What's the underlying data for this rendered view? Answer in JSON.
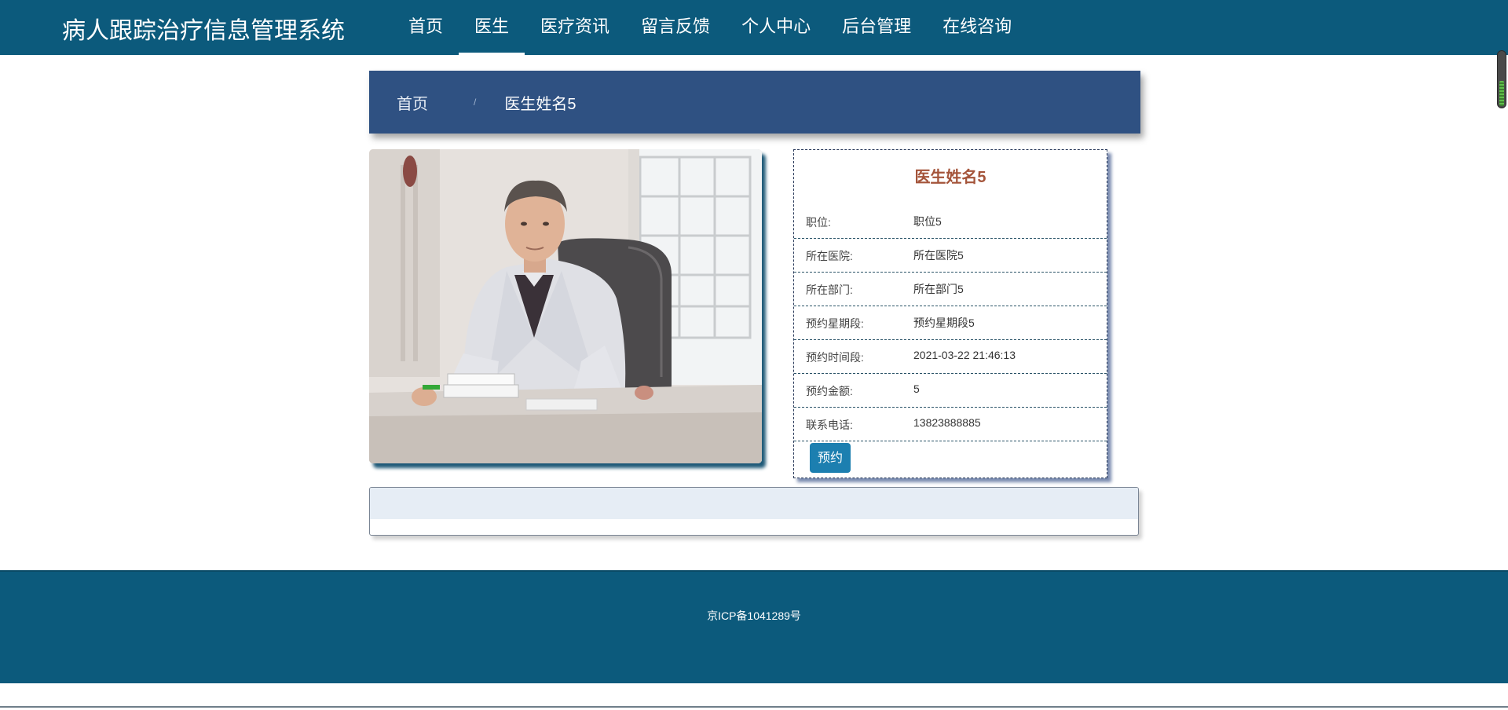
{
  "header": {
    "brand": "病人跟踪治疗信息管理系统",
    "nav": [
      {
        "label": "首页",
        "active": false
      },
      {
        "label": "医生",
        "active": true
      },
      {
        "label": "医疗资讯",
        "active": false
      },
      {
        "label": "留言反馈",
        "active": false
      },
      {
        "label": "个人中心",
        "active": false
      },
      {
        "label": "后台管理",
        "active": false
      },
      {
        "label": "在线咨询",
        "active": false
      }
    ]
  },
  "breadcrumb": {
    "home": "首页",
    "separator": "/",
    "current": "医生姓名5"
  },
  "doctor": {
    "name": "医生姓名5",
    "fields": [
      {
        "label": "职位:",
        "value": "职位5"
      },
      {
        "label": "所在医院:",
        "value": "所在医院5"
      },
      {
        "label": "所在部门:",
        "value": "所在部门5"
      },
      {
        "label": "预约星期段:",
        "value": "预约星期段5"
      },
      {
        "label": "预约时间段:",
        "value": "2021-03-22 21:46:13"
      },
      {
        "label": "预约金额:",
        "value": "5"
      },
      {
        "label": "联系电话:",
        "value": "13823888885"
      }
    ],
    "book_label": "预约"
  },
  "footer": {
    "icp": "京ICP备1041289号"
  },
  "colors": {
    "topbar": "#0c5a7c",
    "breadcrumb": "#2f5182",
    "doctor_name": "#a4543a",
    "button": "#1c7fb0"
  }
}
